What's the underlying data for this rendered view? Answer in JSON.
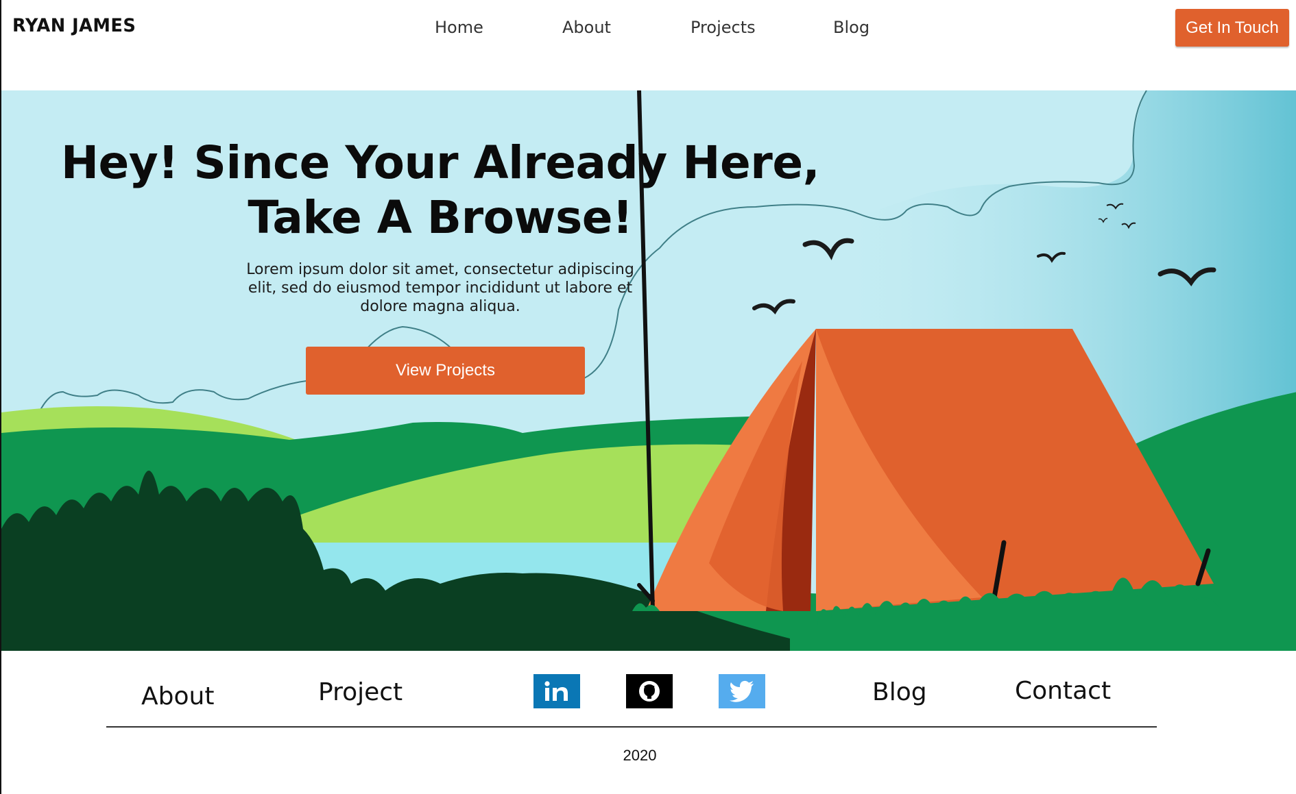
{
  "header": {
    "brand": "RYAN JAMES",
    "nav": [
      "Home",
      "About",
      "Projects",
      "Blog"
    ],
    "cta_label": "Get In Touch"
  },
  "hero": {
    "title_line1": "Hey! Since Your Already Here,",
    "title_line2": "Take A Browse!",
    "body": "Lorem ipsum dolor sit amet, consectetur adipiscing elit, sed do eiusmod tempor incididunt ut labore et dolore magna aliqua.",
    "button_label": "View Projects"
  },
  "footer": {
    "links": [
      "About",
      "Project",
      "Blog",
      "Contact"
    ],
    "social": [
      "linkedin-icon",
      "github-icon",
      "twitter-icon"
    ],
    "year": "2020"
  },
  "colors": {
    "accent": "#e0612d",
    "sky": "#c4ecf3",
    "grass_dark": "#0f9650",
    "grass_light": "#a6e05a",
    "linkedin": "#0a77b5",
    "twitter": "#55acee"
  }
}
